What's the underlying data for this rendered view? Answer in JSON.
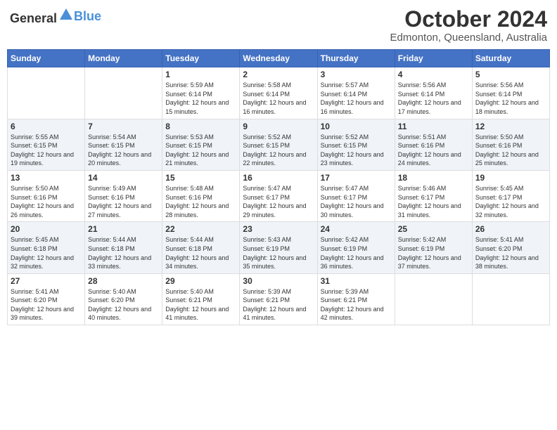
{
  "header": {
    "logo_general": "General",
    "logo_blue": "Blue",
    "month_title": "October 2024",
    "location": "Edmonton, Queensland, Australia"
  },
  "days_of_week": [
    "Sunday",
    "Monday",
    "Tuesday",
    "Wednesday",
    "Thursday",
    "Friday",
    "Saturday"
  ],
  "weeks": [
    [
      {
        "day": "",
        "sunrise": "",
        "sunset": "",
        "daylight": ""
      },
      {
        "day": "",
        "sunrise": "",
        "sunset": "",
        "daylight": ""
      },
      {
        "day": "1",
        "sunrise": "Sunrise: 5:59 AM",
        "sunset": "Sunset: 6:14 PM",
        "daylight": "Daylight: 12 hours and 15 minutes."
      },
      {
        "day": "2",
        "sunrise": "Sunrise: 5:58 AM",
        "sunset": "Sunset: 6:14 PM",
        "daylight": "Daylight: 12 hours and 16 minutes."
      },
      {
        "day": "3",
        "sunrise": "Sunrise: 5:57 AM",
        "sunset": "Sunset: 6:14 PM",
        "daylight": "Daylight: 12 hours and 16 minutes."
      },
      {
        "day": "4",
        "sunrise": "Sunrise: 5:56 AM",
        "sunset": "Sunset: 6:14 PM",
        "daylight": "Daylight: 12 hours and 17 minutes."
      },
      {
        "day": "5",
        "sunrise": "Sunrise: 5:56 AM",
        "sunset": "Sunset: 6:14 PM",
        "daylight": "Daylight: 12 hours and 18 minutes."
      }
    ],
    [
      {
        "day": "6",
        "sunrise": "Sunrise: 5:55 AM",
        "sunset": "Sunset: 6:15 PM",
        "daylight": "Daylight: 12 hours and 19 minutes."
      },
      {
        "day": "7",
        "sunrise": "Sunrise: 5:54 AM",
        "sunset": "Sunset: 6:15 PM",
        "daylight": "Daylight: 12 hours and 20 minutes."
      },
      {
        "day": "8",
        "sunrise": "Sunrise: 5:53 AM",
        "sunset": "Sunset: 6:15 PM",
        "daylight": "Daylight: 12 hours and 21 minutes."
      },
      {
        "day": "9",
        "sunrise": "Sunrise: 5:52 AM",
        "sunset": "Sunset: 6:15 PM",
        "daylight": "Daylight: 12 hours and 22 minutes."
      },
      {
        "day": "10",
        "sunrise": "Sunrise: 5:52 AM",
        "sunset": "Sunset: 6:15 PM",
        "daylight": "Daylight: 12 hours and 23 minutes."
      },
      {
        "day": "11",
        "sunrise": "Sunrise: 5:51 AM",
        "sunset": "Sunset: 6:16 PM",
        "daylight": "Daylight: 12 hours and 24 minutes."
      },
      {
        "day": "12",
        "sunrise": "Sunrise: 5:50 AM",
        "sunset": "Sunset: 6:16 PM",
        "daylight": "Daylight: 12 hours and 25 minutes."
      }
    ],
    [
      {
        "day": "13",
        "sunrise": "Sunrise: 5:50 AM",
        "sunset": "Sunset: 6:16 PM",
        "daylight": "Daylight: 12 hours and 26 minutes."
      },
      {
        "day": "14",
        "sunrise": "Sunrise: 5:49 AM",
        "sunset": "Sunset: 6:16 PM",
        "daylight": "Daylight: 12 hours and 27 minutes."
      },
      {
        "day": "15",
        "sunrise": "Sunrise: 5:48 AM",
        "sunset": "Sunset: 6:16 PM",
        "daylight": "Daylight: 12 hours and 28 minutes."
      },
      {
        "day": "16",
        "sunrise": "Sunrise: 5:47 AM",
        "sunset": "Sunset: 6:17 PM",
        "daylight": "Daylight: 12 hours and 29 minutes."
      },
      {
        "day": "17",
        "sunrise": "Sunrise: 5:47 AM",
        "sunset": "Sunset: 6:17 PM",
        "daylight": "Daylight: 12 hours and 30 minutes."
      },
      {
        "day": "18",
        "sunrise": "Sunrise: 5:46 AM",
        "sunset": "Sunset: 6:17 PM",
        "daylight": "Daylight: 12 hours and 31 minutes."
      },
      {
        "day": "19",
        "sunrise": "Sunrise: 5:45 AM",
        "sunset": "Sunset: 6:17 PM",
        "daylight": "Daylight: 12 hours and 32 minutes."
      }
    ],
    [
      {
        "day": "20",
        "sunrise": "Sunrise: 5:45 AM",
        "sunset": "Sunset: 6:18 PM",
        "daylight": "Daylight: 12 hours and 32 minutes."
      },
      {
        "day": "21",
        "sunrise": "Sunrise: 5:44 AM",
        "sunset": "Sunset: 6:18 PM",
        "daylight": "Daylight: 12 hours and 33 minutes."
      },
      {
        "day": "22",
        "sunrise": "Sunrise: 5:44 AM",
        "sunset": "Sunset: 6:18 PM",
        "daylight": "Daylight: 12 hours and 34 minutes."
      },
      {
        "day": "23",
        "sunrise": "Sunrise: 5:43 AM",
        "sunset": "Sunset: 6:19 PM",
        "daylight": "Daylight: 12 hours and 35 minutes."
      },
      {
        "day": "24",
        "sunrise": "Sunrise: 5:42 AM",
        "sunset": "Sunset: 6:19 PM",
        "daylight": "Daylight: 12 hours and 36 minutes."
      },
      {
        "day": "25",
        "sunrise": "Sunrise: 5:42 AM",
        "sunset": "Sunset: 6:19 PM",
        "daylight": "Daylight: 12 hours and 37 minutes."
      },
      {
        "day": "26",
        "sunrise": "Sunrise: 5:41 AM",
        "sunset": "Sunset: 6:20 PM",
        "daylight": "Daylight: 12 hours and 38 minutes."
      }
    ],
    [
      {
        "day": "27",
        "sunrise": "Sunrise: 5:41 AM",
        "sunset": "Sunset: 6:20 PM",
        "daylight": "Daylight: 12 hours and 39 minutes."
      },
      {
        "day": "28",
        "sunrise": "Sunrise: 5:40 AM",
        "sunset": "Sunset: 6:20 PM",
        "daylight": "Daylight: 12 hours and 40 minutes."
      },
      {
        "day": "29",
        "sunrise": "Sunrise: 5:40 AM",
        "sunset": "Sunset: 6:21 PM",
        "daylight": "Daylight: 12 hours and 41 minutes."
      },
      {
        "day": "30",
        "sunrise": "Sunrise: 5:39 AM",
        "sunset": "Sunset: 6:21 PM",
        "daylight": "Daylight: 12 hours and 41 minutes."
      },
      {
        "day": "31",
        "sunrise": "Sunrise: 5:39 AM",
        "sunset": "Sunset: 6:21 PM",
        "daylight": "Daylight: 12 hours and 42 minutes."
      },
      {
        "day": "",
        "sunrise": "",
        "sunset": "",
        "daylight": ""
      },
      {
        "day": "",
        "sunrise": "",
        "sunset": "",
        "daylight": ""
      }
    ]
  ]
}
